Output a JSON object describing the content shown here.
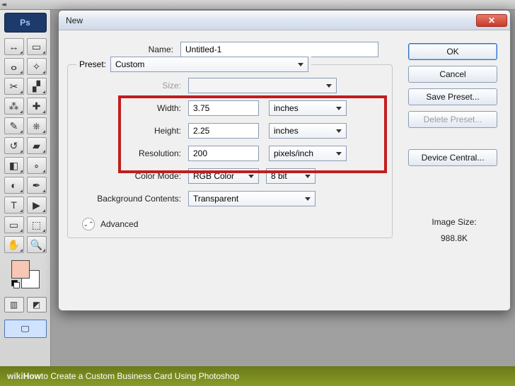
{
  "toolbox": {
    "app_label": "Ps",
    "tools": [
      {
        "name": "move-tool",
        "glyph": "↔"
      },
      {
        "name": "marquee-tool",
        "glyph": "▭"
      },
      {
        "name": "lasso-tool",
        "glyph": "ⴰ"
      },
      {
        "name": "magic-wand-tool",
        "glyph": "✧"
      },
      {
        "name": "crop-tool",
        "glyph": "✂"
      },
      {
        "name": "slice-tool",
        "glyph": "▞"
      },
      {
        "name": "eyedropper-tool",
        "glyph": "⁂"
      },
      {
        "name": "healing-brush-tool",
        "glyph": "✚"
      },
      {
        "name": "brush-tool",
        "glyph": "✎"
      },
      {
        "name": "clone-stamp-tool",
        "glyph": "⎈"
      },
      {
        "name": "history-brush-tool",
        "glyph": "↺"
      },
      {
        "name": "eraser-tool",
        "glyph": "▰"
      },
      {
        "name": "gradient-tool",
        "glyph": "◧"
      },
      {
        "name": "blur-tool",
        "glyph": "∘"
      },
      {
        "name": "dodge-tool",
        "glyph": "◐"
      },
      {
        "name": "pen-tool",
        "glyph": "✒"
      },
      {
        "name": "type-tool",
        "glyph": "T"
      },
      {
        "name": "path-selection-tool",
        "glyph": "▶"
      },
      {
        "name": "shape-tool",
        "glyph": "▭"
      },
      {
        "name": "3d-tool",
        "glyph": "⬚"
      },
      {
        "name": "hand-tool",
        "glyph": "✋"
      },
      {
        "name": "zoom-tool",
        "glyph": "🔍"
      }
    ],
    "foreground_color": "#f7c6b5",
    "background_color": "#ffffff"
  },
  "dialog": {
    "title": "New",
    "name_label": "Name:",
    "name_value": "Untitled-1",
    "preset_label": "Preset:",
    "preset_value": "Custom",
    "size_label": "Size:",
    "size_value": "",
    "width_label": "Width:",
    "width_value": "3.75",
    "width_unit": "inches",
    "height_label": "Height:",
    "height_value": "2.25",
    "height_unit": "inches",
    "resolution_label": "Resolution:",
    "resolution_value": "200",
    "resolution_unit": "pixels/inch",
    "color_mode_label": "Color Mode:",
    "color_mode_value": "RGB Color",
    "bit_depth_value": "8 bit",
    "background_label": "Background Contents:",
    "background_value": "Transparent",
    "advanced_label": "Advanced",
    "image_size_label": "Image Size:",
    "image_size_value": "988.8K"
  },
  "buttons": {
    "ok": "OK",
    "cancel": "Cancel",
    "save_preset": "Save Preset...",
    "delete_preset": "Delete Preset...",
    "device_central": "Device Central..."
  },
  "watermark": {
    "brand1": "wiki",
    "brand2": "How",
    "rest": " to Create a Custom Business Card Using Photoshop"
  }
}
